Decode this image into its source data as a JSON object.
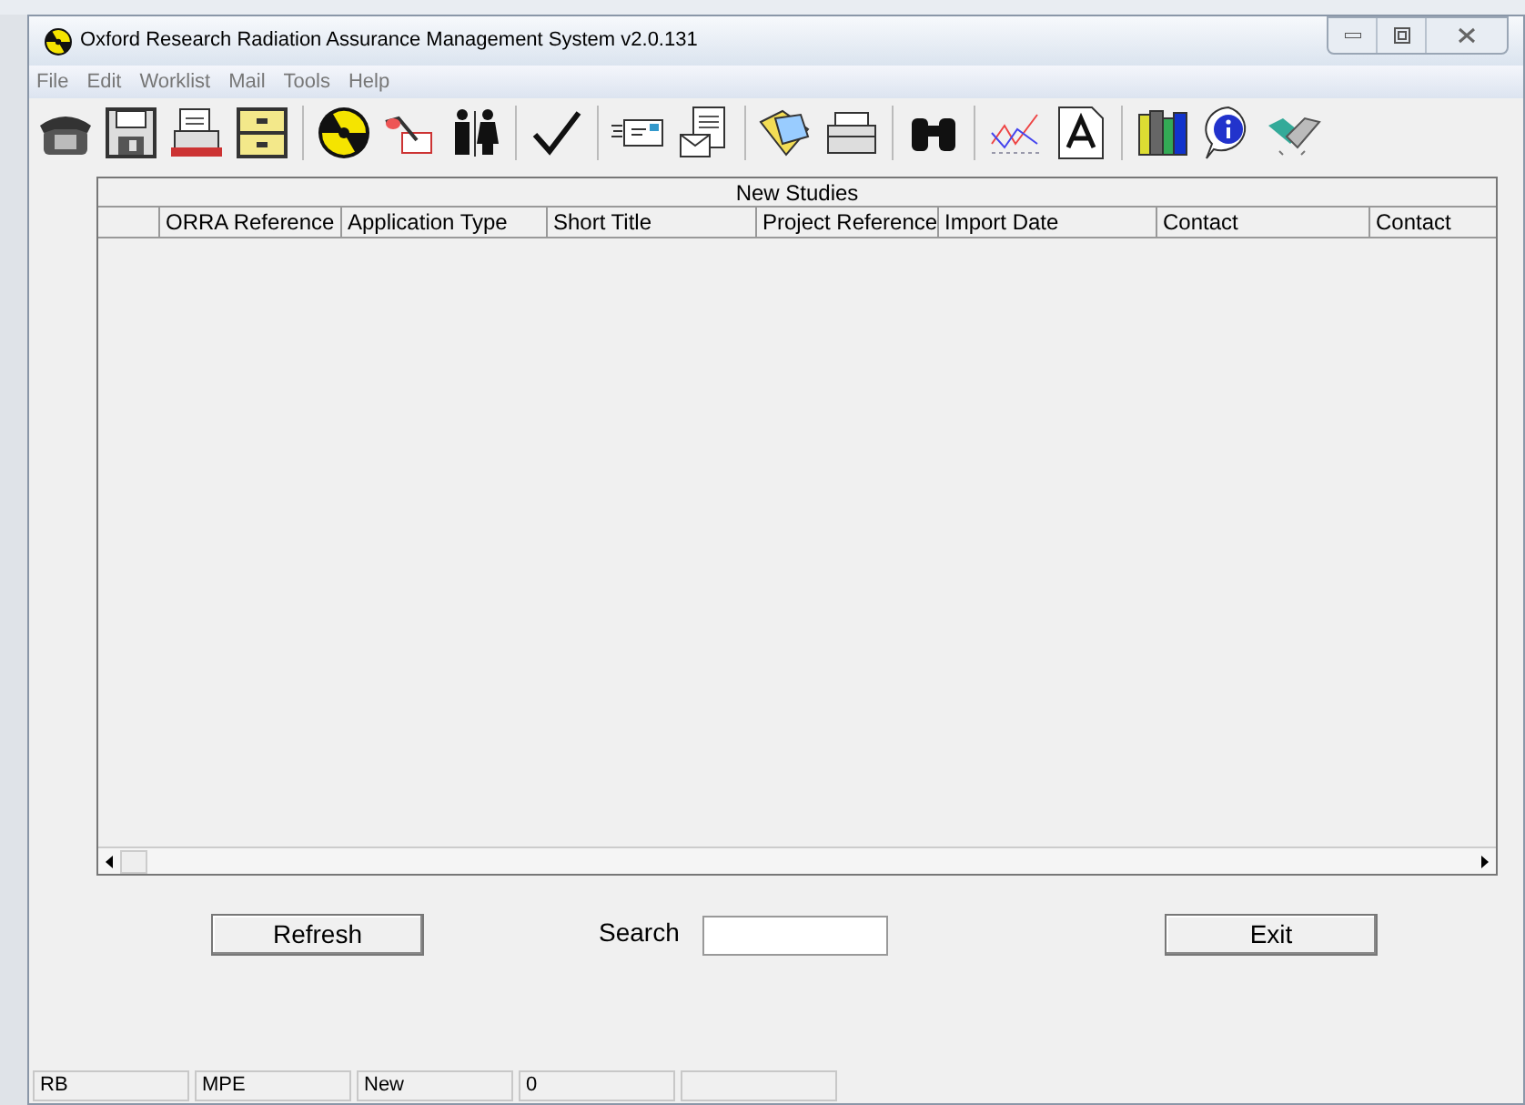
{
  "window": {
    "title": "Oxford Research Radiation Assurance Management System v2.0.131"
  },
  "menu": [
    "File",
    "Edit",
    "Worklist",
    "Mail",
    "Tools",
    "Help"
  ],
  "table": {
    "title": "New Studies",
    "columns": [
      "ORRA Reference",
      "Application Type",
      "Short Title",
      "Project Reference",
      "Import Date",
      "Contact",
      "Contact"
    ]
  },
  "buttons": {
    "refresh": "Refresh",
    "exit": "Exit"
  },
  "search": {
    "label": "Search"
  },
  "status_bar": [
    "RB",
    "MPE",
    "New",
    "0"
  ]
}
